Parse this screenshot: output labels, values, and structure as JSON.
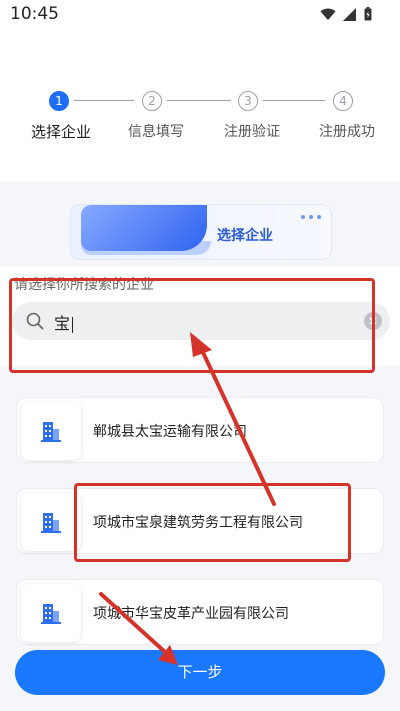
{
  "status_bar": {
    "time": "10:45"
  },
  "stepper": {
    "steps": [
      {
        "number": "1",
        "label": "选择企业"
      },
      {
        "number": "2",
        "label": "信息填写"
      },
      {
        "number": "3",
        "label": "注册验证"
      },
      {
        "number": "4",
        "label": "注册成功"
      }
    ]
  },
  "banner": {
    "title": "选择企业"
  },
  "search": {
    "value": "宝"
  },
  "hint": "请选择你所搜索的企业",
  "companies": [
    {
      "name": "郸城县太宝运输有限公司"
    },
    {
      "name": "项城市宝泉建筑劳务工程有限公司"
    },
    {
      "name": "项城市华宝皮革产业园有限公司"
    }
  ],
  "next_button": {
    "label": "下一步"
  },
  "colors": {
    "accent": "#1a78ff",
    "annotation": "#d5322a"
  }
}
